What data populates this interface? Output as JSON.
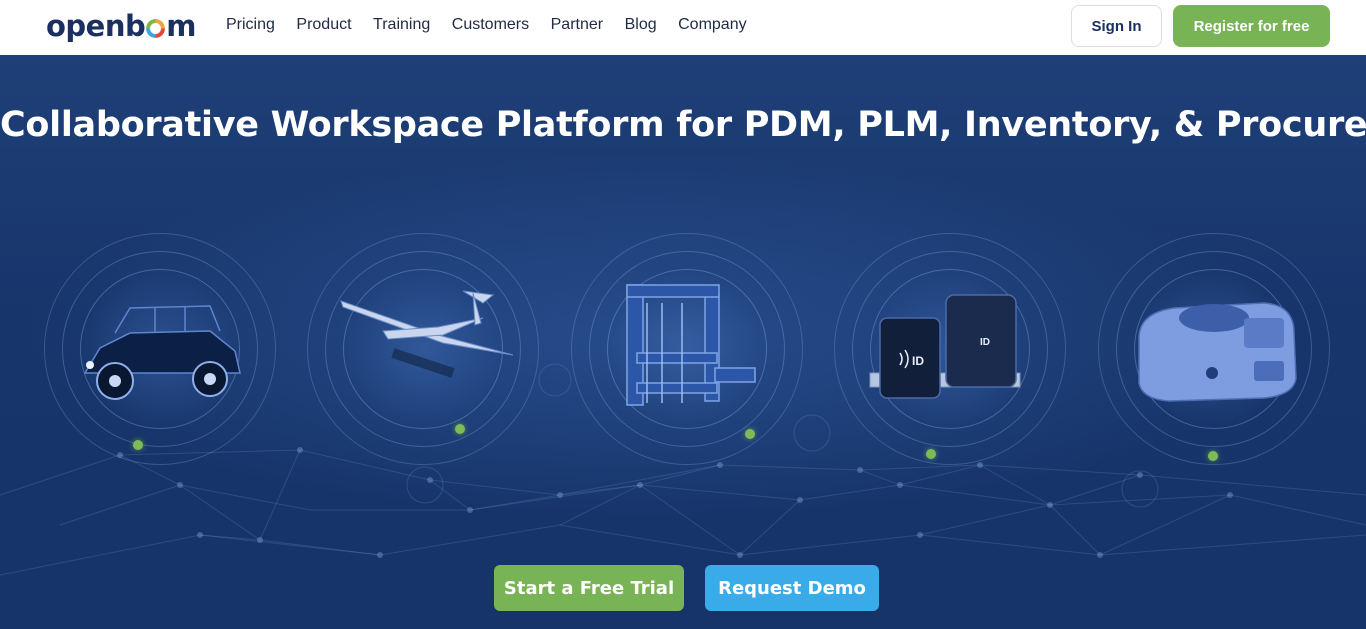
{
  "header": {
    "logo_text_left": "openb",
    "logo_text_right": "m",
    "nav": [
      "Pricing",
      "Product",
      "Training",
      "Customers",
      "Partner",
      "Blog",
      "Company"
    ],
    "sign_in": "Sign In",
    "register": "Register for free"
  },
  "hero": {
    "title": "Collaborative Workspace Platform for PDM, PLM, Inventory, & Procurement",
    "products": [
      {
        "icon": "utility-vehicle-icon"
      },
      {
        "icon": "drone-aircraft-icon"
      },
      {
        "icon": "machine-frame-icon"
      },
      {
        "icon": "id-device-icon"
      },
      {
        "icon": "lab-instrument-icon"
      }
    ],
    "cta_trial": "Start a Free Trial",
    "cta_demo": "Request Demo"
  },
  "colors": {
    "accent_green": "#78b356",
    "accent_blue": "#3aabe9",
    "brand_navy": "#1b3060",
    "hero_bg": "#1b3a6e"
  }
}
